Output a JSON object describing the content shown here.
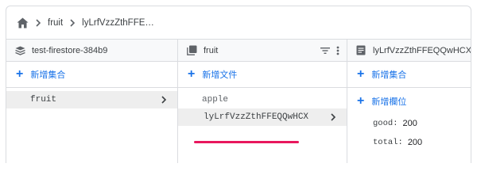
{
  "breadcrumb": {
    "items": [
      "fruit",
      "lyLrfVzzZthFFE…"
    ]
  },
  "columns": {
    "project": {
      "title": "test-firestore-384b9",
      "add_label": "新增集合",
      "items": [
        "fruit"
      ]
    },
    "collection": {
      "title": "fruit",
      "add_label": "新增文件",
      "items": [
        "apple",
        "lyLrfVzzZthFFEQQwHCX"
      ]
    },
    "document": {
      "title": "lyLrfVzzZthFFEQQwHCX",
      "add_collection_label": "新增集合",
      "add_field_label": "新增欄位",
      "fields": [
        {
          "key": "good:",
          "value": "200"
        },
        {
          "key": "total:",
          "value": "200"
        }
      ]
    }
  },
  "colors": {
    "accent": "#1a73e8",
    "highlight": "#e8175d",
    "selected_bg": "#eeeeee"
  },
  "icons": [
    "home-icon",
    "chevron-right-icon",
    "database-icon",
    "collection-icon",
    "document-icon",
    "filter-icon",
    "more-vert-icon"
  ]
}
